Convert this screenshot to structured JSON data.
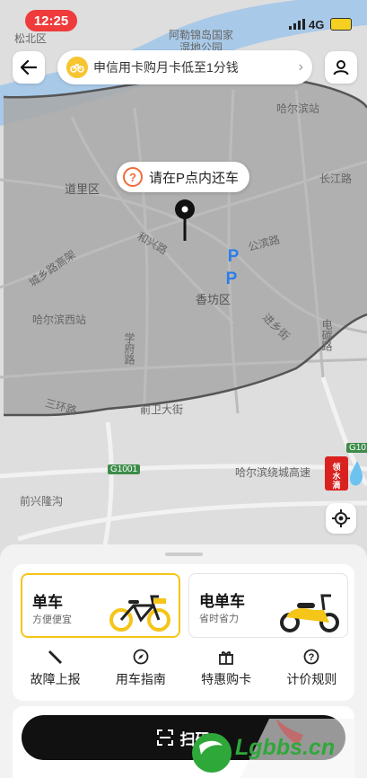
{
  "status_bar": {
    "time": "12:25",
    "network": "4G"
  },
  "banner": {
    "text": "申信用卡购月卡低至1分钱"
  },
  "map": {
    "labels": {
      "songbei": "松北区",
      "amur_l1": "阿勒锦岛国家",
      "amur_l2": "湿地公园",
      "harbin_station": "哈尔滨站",
      "daoli": "道里区",
      "changjiang": "长江路",
      "hexing": "和兴路",
      "gongbin": "公滨路",
      "chengxiang": "城乡路高架",
      "xiangfang": "香坊区",
      "harbin_west": "哈尔滨西站",
      "xuefu": "学府路",
      "jinxiang": "进乡街",
      "dianbi": "电碳路",
      "sanhuan": "三环路",
      "qianwei": "前卫大街",
      "g1001": "G1001",
      "g10": "G10",
      "ring_expressway": "哈尔滨绕城高速",
      "qianxing": "前兴隆沟"
    },
    "callout": "请在P点内还车",
    "parking_marker": "P"
  },
  "vehicles": [
    {
      "title": "单车",
      "subtitle": "方便便宜",
      "selected": true
    },
    {
      "title": "电单车",
      "subtitle": "省时省力",
      "selected": false
    }
  ],
  "actions": [
    {
      "label": "故障上报",
      "icon": "wrench-icon"
    },
    {
      "label": "用车指南",
      "icon": "compass-icon"
    },
    {
      "label": "特惠购卡",
      "icon": "gift-icon"
    },
    {
      "label": "计价规则",
      "icon": "help-icon"
    }
  ],
  "scan": {
    "label": "扫码"
  },
  "promo": {
    "text": "领水滴"
  },
  "watermark": {
    "text": "Lgbbs.cn"
  },
  "colors": {
    "accent": "#f5c518",
    "alert": "#ef3b3b",
    "parking": "#2b7de9",
    "dark": "#111111"
  }
}
